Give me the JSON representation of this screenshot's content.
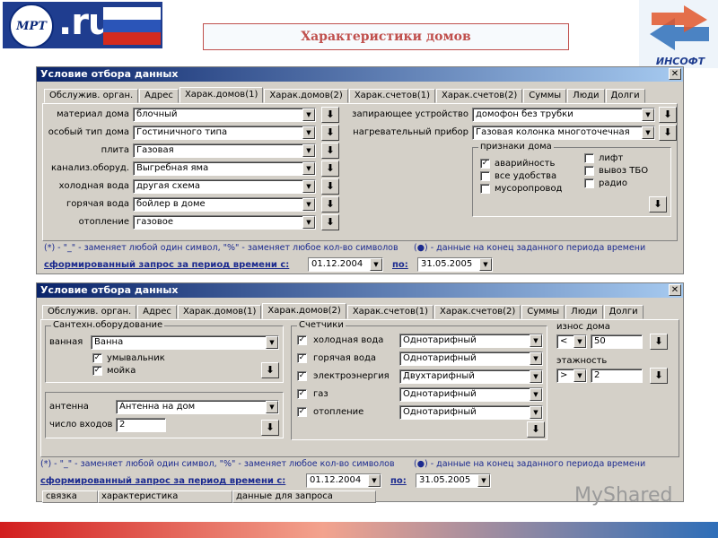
{
  "header": {
    "logo_text": "МРТ",
    "logo_domain": ".ru",
    "title": "Характеристики домов",
    "company": "ИНСОФТ"
  },
  "w1": {
    "title": "Условие отбора данных",
    "close": "✕",
    "tabs": [
      "Обслужив. орган.",
      "Адрес",
      "Харак.домов(1)",
      "Харак.домов(2)",
      "Харак.счетов(1)",
      "Харак.счетов(2)",
      "Суммы",
      "Люди",
      "Долги"
    ],
    "rows": [
      {
        "label": "материал дома",
        "value": "блочный"
      },
      {
        "label": "особый тип дома",
        "value": "Гостиничного типа"
      },
      {
        "label": "плита",
        "value": "Газовая"
      },
      {
        "label": "канализ.оборуд.",
        "value": "Выгребная яма"
      },
      {
        "label": "холодная вода",
        "value": "другая схема"
      },
      {
        "label": "горячая вода",
        "value": "бойлер в доме"
      },
      {
        "label": "отопление",
        "value": "газовое"
      }
    ],
    "lock_label": "запирающее устройство",
    "lock_value": "домофон без трубки",
    "heater_label": "нагревательный прибор",
    "heater_value": "Газовая колонка многоточечная",
    "features_title": "признаки дома",
    "features_left": [
      {
        "label": "аварийность",
        "checked": true
      },
      {
        "label": "все удобства",
        "checked": false
      },
      {
        "label": "мусоропровод",
        "checked": false
      }
    ],
    "features_right": [
      {
        "label": "лифт",
        "checked": false
      },
      {
        "label": "вывоз ТБО",
        "checked": false
      },
      {
        "label": "радио",
        "checked": false
      }
    ],
    "footnote_left": "(*) - \"_\" - заменяет любой один символ, \"%\" - заменяет любое кол-во символов",
    "footnote_right": "(●) - данные на конец заданного периода времени",
    "query_link": "сформированный запрос за период времени с:",
    "date_from": "01.12.2004",
    "to_label": "по:",
    "date_to": "31.05.2005"
  },
  "w2": {
    "title": "Условие отбора данных",
    "close": "✕",
    "tabs": [
      "Обслужив. орган.",
      "Адрес",
      "Харак.домов(1)",
      "Харак.домов(2)",
      "Харак.счетов(1)",
      "Харак.счетов(2)",
      "Суммы",
      "Люди",
      "Долги"
    ],
    "sanitary_title": "Сантехн.оборудование",
    "bath_label": "ванная",
    "bath_value": "Ванна",
    "sink_label": "умывальник",
    "wash_label": "мойка",
    "antenna_label": "антенна",
    "antenna_value": "Антенна на дом",
    "entrances_label": "число входов",
    "entrances_value": "2",
    "meters_title": "Счетчики",
    "meters": [
      {
        "label": "холодная вода",
        "value": "Однотарифный"
      },
      {
        "label": "горячая вода",
        "value": "Однотарифный"
      },
      {
        "label": "электроэнергия",
        "value": "Двухтарифный"
      },
      {
        "label": "газ",
        "value": "Однотарифный"
      },
      {
        "label": "отопление",
        "value": "Однотарифный"
      }
    ],
    "wear_label": "износ дома",
    "wear_op": "<",
    "wear_value": "50",
    "floors_label": "этажность",
    "floors_op": ">",
    "floors_value": "2",
    "footnote_left": "(*) - \"_\" - заменяет любой один символ, \"%\" - заменяет любое кол-во символов",
    "footnote_right": "(●) - данные на конец заданного периода времени",
    "query_link": "сформированный запрос за период времени с:",
    "date_from": "01.12.2004",
    "to_label": "по:",
    "date_to": "31.05.2005",
    "grid_headers": [
      "связка",
      "характеристика",
      "данные для запроса"
    ]
  },
  "watermark": "MyShared",
  "icons": {
    "dropdown": "▼",
    "load": "⬇",
    "check": "✓"
  }
}
